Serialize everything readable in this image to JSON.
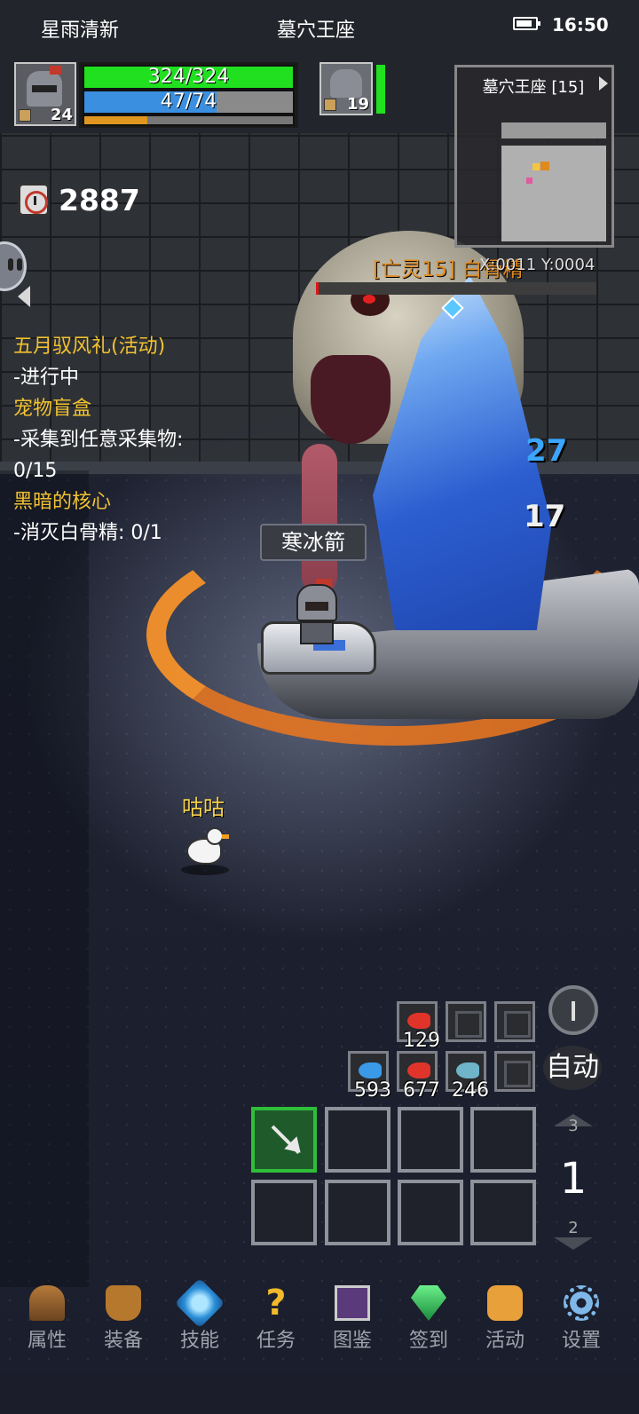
{
  "status_bar": {
    "left_text": "星雨清新",
    "center_text": "墓穴王座",
    "time": "16:50"
  },
  "player": {
    "level": "24",
    "hp": "324/324",
    "hp_fraction": 1.0,
    "mp": "47/74",
    "mp_fraction": 0.635,
    "xp_fraction": 0.3
  },
  "pet_companion": {
    "level": "19",
    "hp_fraction": 1.0
  },
  "timer": "2887",
  "minimap": {
    "title": "墓穴王座 [15]",
    "coords": "X:0011  Y:0004"
  },
  "quests": [
    {
      "title": "五月驭风礼(活动)",
      "lines": [
        "-进行中"
      ]
    },
    {
      "title": "宠物盲盒",
      "lines": [
        "-采集到任意采集物:",
        "0/15"
      ]
    },
    {
      "title": "黑暗的核心",
      "lines": [
        "-消灭白骨精: 0/1"
      ]
    }
  ],
  "boss": {
    "name": "[亡灵15] 白骨精",
    "hp_fraction": 0.01
  },
  "damage_numbers": {
    "blue": "27",
    "white": "17"
  },
  "skill_cast_label": "寒冰箭",
  "pet_name": "咕咕",
  "consumables": {
    "row1": [
      {
        "icon": "red-fish-icon",
        "qty": "129"
      },
      {
        "icon": "empty-slot",
        "qty": ""
      },
      {
        "icon": "empty-slot",
        "qty": ""
      }
    ],
    "row2": [
      {
        "icon": "blue-fish-icon",
        "qty": "593"
      },
      {
        "icon": "red-fish-icon",
        "qty": "677"
      },
      {
        "icon": "teal-fish-icon",
        "qty": "246"
      },
      {
        "icon": "empty-slot",
        "qty": ""
      }
    ]
  },
  "controls": {
    "auto_label": "自动",
    "page_up": "3",
    "page_current": "1",
    "page_down": "2"
  },
  "bottom_nav": [
    {
      "label": "属性",
      "icon": "helmet-icon"
    },
    {
      "label": "装备",
      "icon": "bag-icon"
    },
    {
      "label": "技能",
      "icon": "skill-crystal-icon"
    },
    {
      "label": "任务",
      "icon": "question-icon"
    },
    {
      "label": "图鉴",
      "icon": "book-icon"
    },
    {
      "label": "签到",
      "icon": "gem-icon"
    },
    {
      "label": "活动",
      "icon": "smile-icon"
    },
    {
      "label": "设置",
      "icon": "gear-icon"
    }
  ],
  "colors": {
    "hp": "#20e020",
    "mp": "#3b8fe0",
    "xp": "#e0961f",
    "quest_title": "#f2c230",
    "boss_name": "#e08a1e",
    "skill_slot_active": "#2fbe3a"
  }
}
